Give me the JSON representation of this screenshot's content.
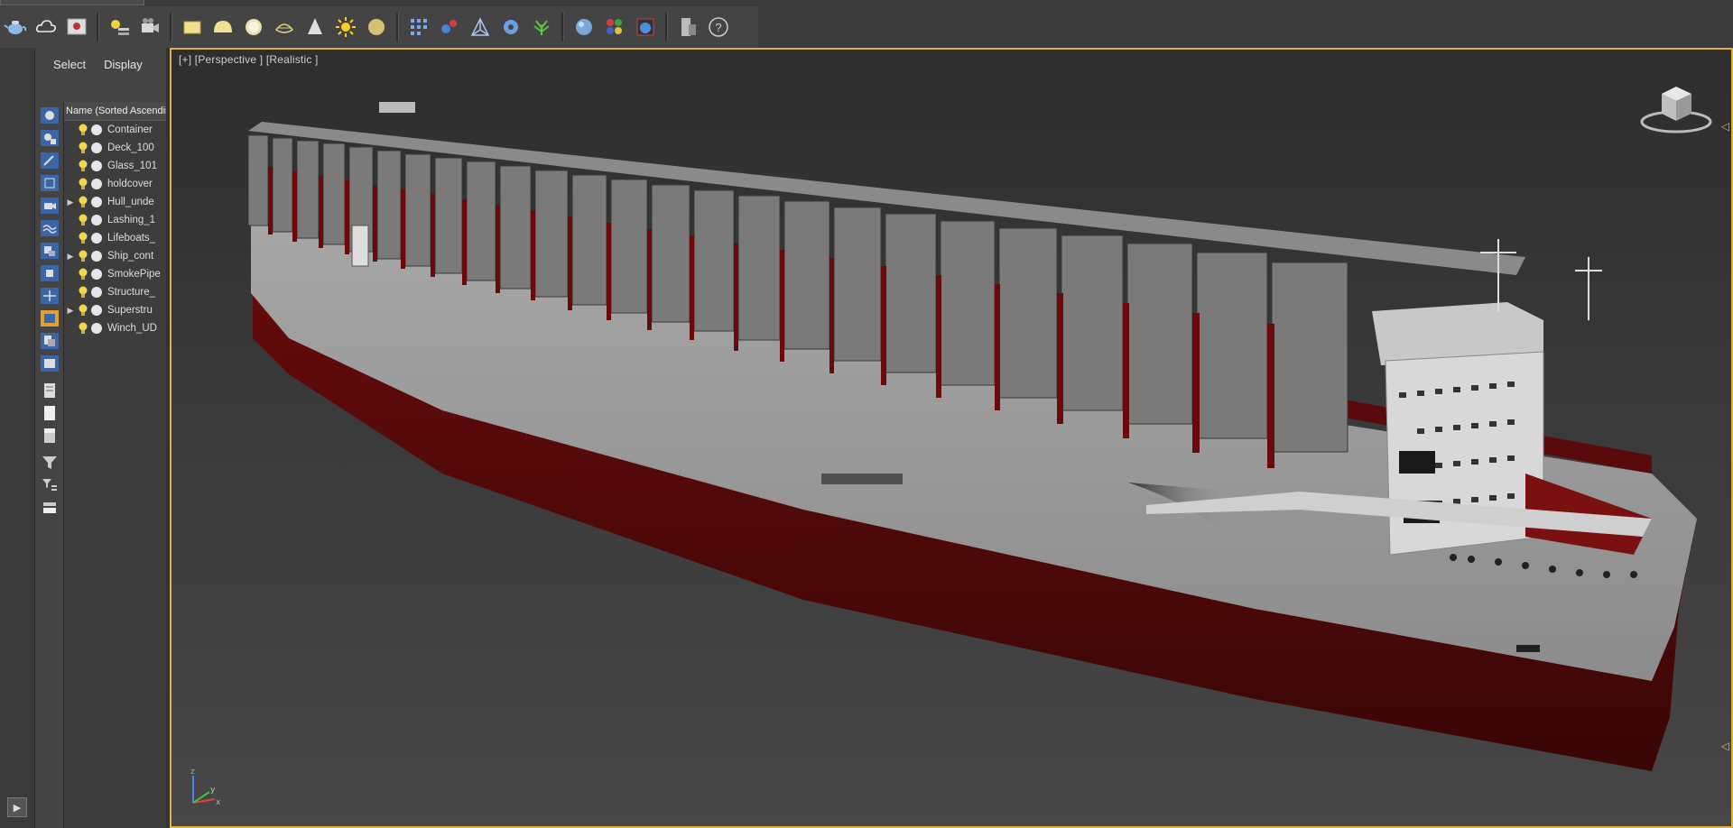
{
  "toolbar": {
    "icons": [
      "teapot-icon",
      "cloud-icon",
      "image-icon",
      "lights-icon",
      "camera-icon",
      "box-icon",
      "dome-icon",
      "sphere-icon",
      "helix-icon",
      "cone-icon",
      "sun-icon",
      "disc-icon",
      "grid-icon",
      "molecule-icon",
      "network-icon",
      "gear-icon",
      "plant-icon",
      "globe-icon",
      "palette-icon",
      "render-icon",
      "device-icon",
      "help-icon"
    ]
  },
  "scene_explorer": {
    "tab_select": "Select",
    "tab_display": "Display",
    "column_header": "Name (Sorted Ascending)",
    "items": [
      {
        "label": "Container",
        "expandable": false
      },
      {
        "label": "Deck_100",
        "expandable": false
      },
      {
        "label": "Glass_101",
        "expandable": false
      },
      {
        "label": "holdcover",
        "expandable": false
      },
      {
        "label": "Hull_unde",
        "expandable": true
      },
      {
        "label": "Lashing_1",
        "expandable": false
      },
      {
        "label": "Lifeboats_",
        "expandable": false
      },
      {
        "label": "Ship_cont",
        "expandable": true
      },
      {
        "label": "SmokePipe",
        "expandable": false
      },
      {
        "label": "Structure_",
        "expandable": false
      },
      {
        "label": "Superstru",
        "expandable": true
      },
      {
        "label": "Winch_UD",
        "expandable": false
      }
    ]
  },
  "viewport": {
    "label": "[+] [Perspective ] [Realistic ]",
    "axis_x": "x",
    "axis_y": "y",
    "axis_z": "z"
  },
  "colors": {
    "accent": "#d9b440",
    "hull_red": "#5a0a0a",
    "hull_white": "#9a9a9a",
    "container_gray": "#7a7a7a"
  }
}
